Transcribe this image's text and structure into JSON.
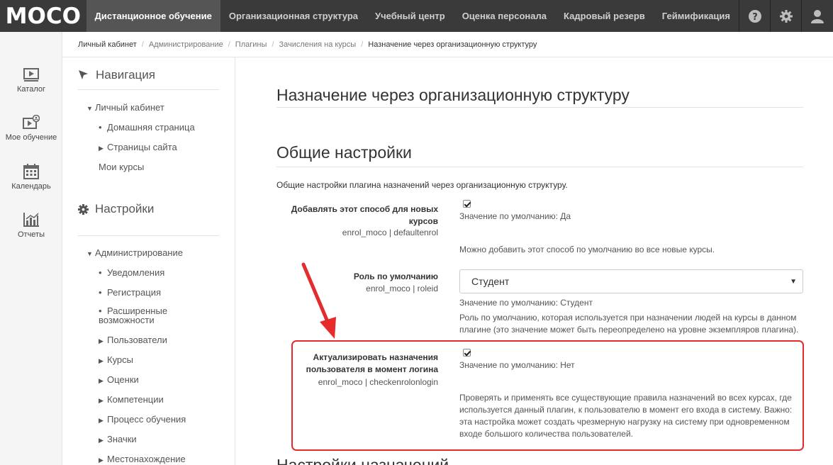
{
  "logo": "MOCO",
  "top_nav": [
    {
      "label": "Дистанционное обучение",
      "active": true
    },
    {
      "label": "Организационная структура"
    },
    {
      "label": "Учебный центр"
    },
    {
      "label": "Оценка персонала"
    },
    {
      "label": "Кадровый резерв"
    },
    {
      "label": "Геймификация"
    }
  ],
  "top_icons": [
    "help-icon",
    "gear-icon",
    "user-icon"
  ],
  "rail": [
    {
      "label": "Каталог",
      "icon": "catalog-icon"
    },
    {
      "label": "Мое обучение",
      "icon": "my-learning-icon"
    },
    {
      "label": "Календарь",
      "icon": "calendar-icon"
    },
    {
      "label": "Отчеты",
      "icon": "reports-icon"
    }
  ],
  "breadcrumb": [
    "Личный кабинет",
    "Администрирование",
    "Плагины",
    "Зачисления на курсы",
    "Назначение через организационную структуру"
  ],
  "navigation_block": {
    "title": "Навигация",
    "items": [
      {
        "label": "Личный кабинет",
        "marker": "expanded"
      },
      {
        "label": "Домашняя страница",
        "marker": "bullet"
      },
      {
        "label": "Страницы сайта",
        "marker": "collapsed"
      },
      {
        "label": "Мои курсы",
        "marker": "none"
      }
    ]
  },
  "settings_block": {
    "title": "Настройки",
    "items": [
      {
        "label": "Администрирование",
        "marker": "expanded"
      },
      {
        "label": "Уведомления",
        "marker": "bullet"
      },
      {
        "label": "Регистрация",
        "marker": "bullet"
      },
      {
        "label": "Расширенные",
        "marker": "bullet"
      },
      {
        "label": "возможности",
        "marker": "none"
      },
      {
        "label": "Пользователи",
        "marker": "collapsed"
      },
      {
        "label": "Курсы",
        "marker": "collapsed"
      },
      {
        "label": "Оценки",
        "marker": "collapsed"
      },
      {
        "label": "Компетенции",
        "marker": "collapsed"
      },
      {
        "label": "Процесс обучения",
        "marker": "collapsed"
      },
      {
        "label": "Значки",
        "marker": "collapsed"
      },
      {
        "label": "Местонахождение",
        "marker": "collapsed"
      }
    ]
  },
  "main": {
    "page_title": "Назначение через организационную структуру",
    "section_title": "Общие настройки",
    "intro": "Общие настройки плагина назначений через организационную структуру.",
    "settings": [
      {
        "label_line1": "Добавлять этот способ для новых",
        "label_line2": "курсов",
        "key": "enrol_moco | defaultenrol",
        "checked": true,
        "default": "Значение по умолчанию: Да",
        "description": "Можно добавить этот способ по умолчанию во все новые курсы."
      },
      {
        "label_line1": "Роль по умолчанию",
        "key": "enrol_moco | roleid",
        "select_value": "Студент",
        "default": "Значение по умолчанию: Студент",
        "description_line1": "Роль по умолчанию, которая используется при назначении людей на курсы в данном",
        "description_line2": "плагине (это значение может быть переопределено на уровне экземпляров плагина)."
      },
      {
        "label_line1": "Актуализировать назначения",
        "label_line2": "пользователя в момент логина",
        "key": "enrol_moco | checkenrolonlogin",
        "checked": true,
        "default": "Значение по умолчанию: Нет",
        "description_line1": "Проверять и применять все существующие правила назначений во всех курсах, где",
        "description_line2": "используется данный плагин, к пользователю в момент его входа в систему. Важно:",
        "description_line3": "эта настройка может создать чрезмерную нагрузку на систему при одновременном",
        "description_line4": "входе большого количества пользователей."
      }
    ],
    "next_heading_partial": "Настройки назначений"
  },
  "colors": {
    "topbar": "#3a3a3a",
    "highlight": "#e52b2b"
  }
}
